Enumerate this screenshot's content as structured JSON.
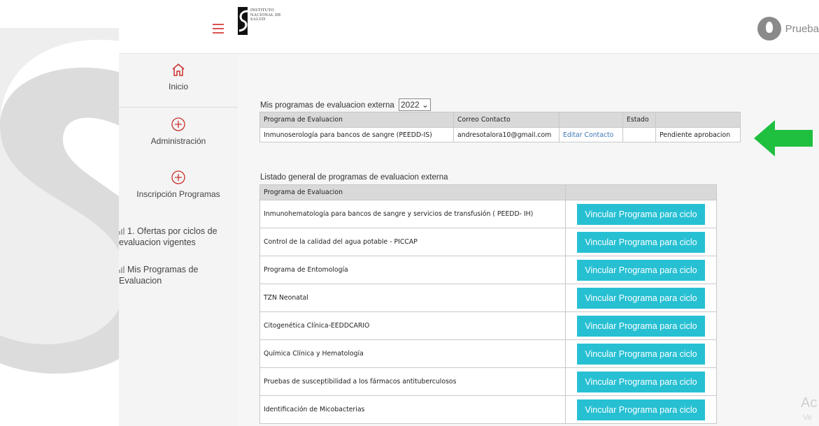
{
  "header": {
    "logo_lines": [
      "INSTITUTO",
      "NACIONAL DE",
      "SALUD"
    ],
    "user_name": "Prueba"
  },
  "sidebar": {
    "items": [
      {
        "label": "Inicio",
        "icon": "home-icon"
      },
      {
        "label": "Administración",
        "icon": "plus-circle-icon"
      },
      {
        "label": "Inscripción Programas",
        "icon": "plus-circle-icon"
      }
    ],
    "sub_items": [
      {
        "line1": "1. Ofertas por ciclos de",
        "line2": "evaluacion vigentes",
        "icon": "bar-chart-icon"
      },
      {
        "line1": "Mis Programas de",
        "line2": "Evaluacion",
        "icon": "bar-chart-icon"
      }
    ],
    "accent_color": "#d9534f"
  },
  "my_programs": {
    "title": "Mis programas de evaluacion externa",
    "year": "2022",
    "headers": [
      "Programa de Evaluacion",
      "Correo Contacto",
      "",
      "Estado",
      ""
    ],
    "rows": [
      {
        "program": "Inmunoserología para bancos de sangre (PEEDD-IS)",
        "email": "andresotalora10@gmail.com",
        "action": "Editar Contacto",
        "estado": "",
        "status": "Pendiente aprobacion"
      }
    ]
  },
  "general_list": {
    "title": "Listado general de programas de evaluacion externa",
    "header": "Programa de Evaluacion",
    "button_label": "Vincular Programa para ciclo",
    "button_color": "#27c0d3",
    "programs": [
      "Inmunohematología para bancos de sangre y servicios de transfusión ( PEEDD- IH)",
      "Control de la calidad del agua potable - PICCAP",
      "Programa de Entomología",
      "TZN Neonatal",
      "Citogenética Clínica-EEDDCARIO",
      "Química Clínica y Hematología",
      "Pruebas de susceptibilidad a los fármacos antituberculosos",
      "Identificación de Micobacterias"
    ]
  },
  "annotation": {
    "arrow_color": "#1fbf3f"
  },
  "watermark": {
    "line1": "Ac",
    "line2": "Ve"
  }
}
